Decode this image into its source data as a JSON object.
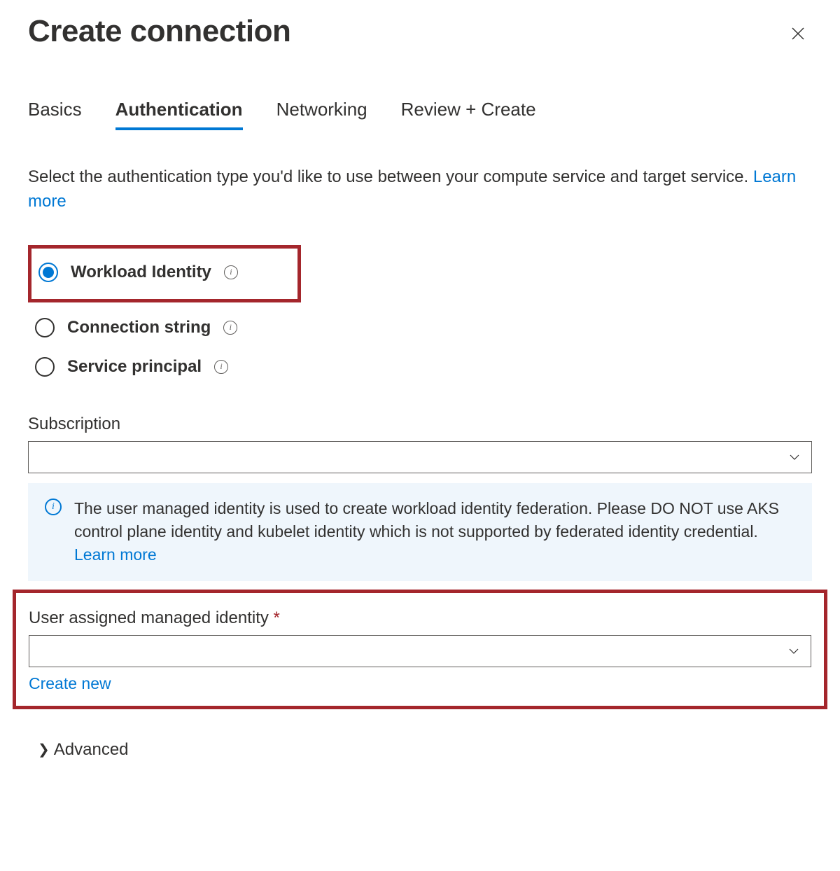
{
  "header": {
    "title": "Create connection"
  },
  "tabs": {
    "basics": "Basics",
    "authentication": "Authentication",
    "networking": "Networking",
    "review": "Review + Create"
  },
  "description": {
    "text": "Select the authentication type you'd like to use between your compute service and target service. ",
    "learn_more": "Learn more"
  },
  "auth_options": {
    "workload_identity": "Workload Identity",
    "connection_string": "Connection string",
    "service_principal": "Service principal"
  },
  "subscription": {
    "label": "Subscription",
    "value": ""
  },
  "info_banner": {
    "text": "The user managed identity is used to create workload identity federation. Please DO NOT use AKS control plane identity and kubelet identity which is not supported by federated identity credential. ",
    "learn_more": "Learn more"
  },
  "uami": {
    "label": "User assigned managed identity",
    "required_mark": "*",
    "value": "",
    "create_new": "Create new"
  },
  "advanced": {
    "label": "Advanced"
  },
  "icons": {
    "info_glyph": "i"
  }
}
